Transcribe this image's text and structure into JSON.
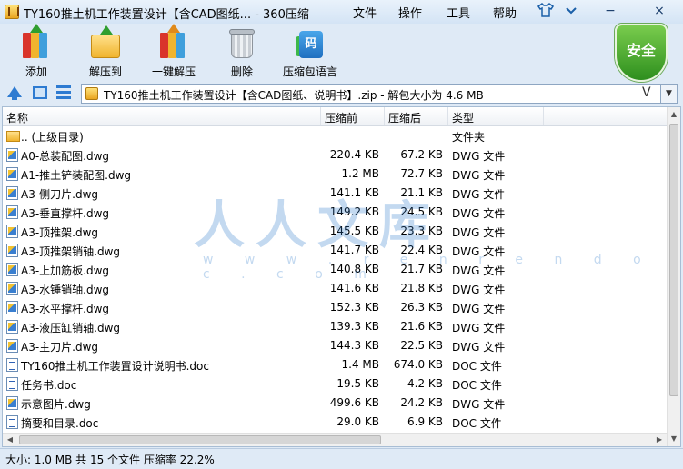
{
  "title": "TY160推土机工作装置设计【含CAD图纸... - 360压缩",
  "menu": {
    "file": "文件",
    "operate": "操作",
    "tools": "工具",
    "help": "帮助"
  },
  "window_controls": {
    "minimize": "−",
    "close": "×"
  },
  "toolbar": {
    "add": "添加",
    "extract_to": "解压到",
    "quick_extract": "一键解压",
    "delete": "删除",
    "language": "压缩包语言",
    "language_glyph": "码"
  },
  "safe_badge": "安全",
  "address": {
    "path": "TY160推土机工作装置设计【含CAD图纸、说明书】.zip - 解包大小为 4.6 MB",
    "v_glyph": "V"
  },
  "columns": {
    "name": "名称",
    "packed": "压缩前",
    "unpacked": "压缩后",
    "type": "类型"
  },
  "files": [
    {
      "name": ".. (上级目录)",
      "packed": "",
      "unpacked": "",
      "type": "文件夹",
      "icon": "folder"
    },
    {
      "name": "A0-总装配图.dwg",
      "packed": "220.4 KB",
      "unpacked": "67.2 KB",
      "type": "DWG 文件",
      "icon": "dwg"
    },
    {
      "name": "A1-推土铲装配图.dwg",
      "packed": "1.2 MB",
      "unpacked": "72.7 KB",
      "type": "DWG 文件",
      "icon": "dwg"
    },
    {
      "name": "A3-侧刀片.dwg",
      "packed": "141.1 KB",
      "unpacked": "21.1 KB",
      "type": "DWG 文件",
      "icon": "dwg"
    },
    {
      "name": "A3-垂直撑杆.dwg",
      "packed": "149.2 KB",
      "unpacked": "24.5 KB",
      "type": "DWG 文件",
      "icon": "dwg"
    },
    {
      "name": "A3-顶推架.dwg",
      "packed": "145.5 KB",
      "unpacked": "23.3 KB",
      "type": "DWG 文件",
      "icon": "dwg"
    },
    {
      "name": "A3-顶推架销轴.dwg",
      "packed": "141.7 KB",
      "unpacked": "22.4 KB",
      "type": "DWG 文件",
      "icon": "dwg"
    },
    {
      "name": "A3-上加筋板.dwg",
      "packed": "140.8 KB",
      "unpacked": "21.7 KB",
      "type": "DWG 文件",
      "icon": "dwg"
    },
    {
      "name": "A3-水锤销轴.dwg",
      "packed": "141.6 KB",
      "unpacked": "21.8 KB",
      "type": "DWG 文件",
      "icon": "dwg"
    },
    {
      "name": "A3-水平撑杆.dwg",
      "packed": "152.3 KB",
      "unpacked": "26.3 KB",
      "type": "DWG 文件",
      "icon": "dwg"
    },
    {
      "name": "A3-液压缸销轴.dwg",
      "packed": "139.3 KB",
      "unpacked": "21.6 KB",
      "type": "DWG 文件",
      "icon": "dwg"
    },
    {
      "name": "A3-主刀片.dwg",
      "packed": "144.3 KB",
      "unpacked": "22.5 KB",
      "type": "DWG 文件",
      "icon": "dwg"
    },
    {
      "name": "TY160推土机工作装置设计说明书.doc",
      "packed": "1.4 MB",
      "unpacked": "674.0 KB",
      "type": "DOC 文件",
      "icon": "doc"
    },
    {
      "name": "任务书.doc",
      "packed": "19.5 KB",
      "unpacked": "4.2 KB",
      "type": "DOC 文件",
      "icon": "doc"
    },
    {
      "name": "示意图片.dwg",
      "packed": "499.6 KB",
      "unpacked": "24.2 KB",
      "type": "DWG 文件",
      "icon": "dwg"
    },
    {
      "name": "摘要和目录.doc",
      "packed": "29.0 KB",
      "unpacked": "6.9 KB",
      "type": "DOC 文件",
      "icon": "doc"
    }
  ],
  "watermark": {
    "main": "人人文库",
    "url": "w w w . r e n r e n d o c . c o m"
  },
  "status": "大小: 1.0 MB 共 15 个文件 压缩率 22.2%"
}
